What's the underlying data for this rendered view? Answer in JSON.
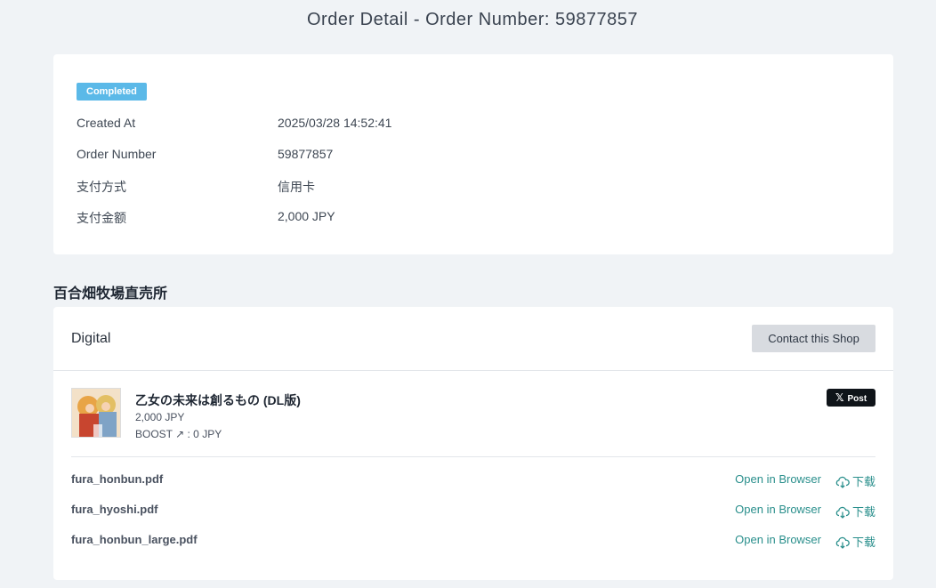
{
  "page": {
    "title": "Order Detail - Order Number: 59877857"
  },
  "summary": {
    "status_badge": "Completed",
    "rows": [
      {
        "label": "Created At",
        "value": "2025/03/28 14:52:41"
      },
      {
        "label": "Order Number",
        "value": "59877857"
      },
      {
        "label": "支付方式",
        "value": "信用卡"
      },
      {
        "label": "支付金额",
        "value": "2,000 JPY"
      }
    ]
  },
  "shop": {
    "name": "百合畑牧場直売所",
    "section_title": "Digital",
    "contact_label": "Contact this Shop"
  },
  "item": {
    "title": "乙女の未来は創るもの (DL版)",
    "price": "2,000 JPY",
    "boost": "BOOST ↗ : 0 JPY",
    "post_label": "Post",
    "thumbnail_icon": "product-thumbnail"
  },
  "files": [
    {
      "name": "fura_honbun.pdf",
      "open_label": "Open in Browser",
      "download_label": "下载"
    },
    {
      "name": "fura_hyoshi.pdf",
      "open_label": "Open in Browser",
      "download_label": "下载"
    },
    {
      "name": "fura_honbun_large.pdf",
      "open_label": "Open in Browser",
      "download_label": "下载"
    }
  ],
  "colors": {
    "badge": "#5bb9e8",
    "link": "#2a8f8c",
    "background": "#f0f3f6"
  }
}
